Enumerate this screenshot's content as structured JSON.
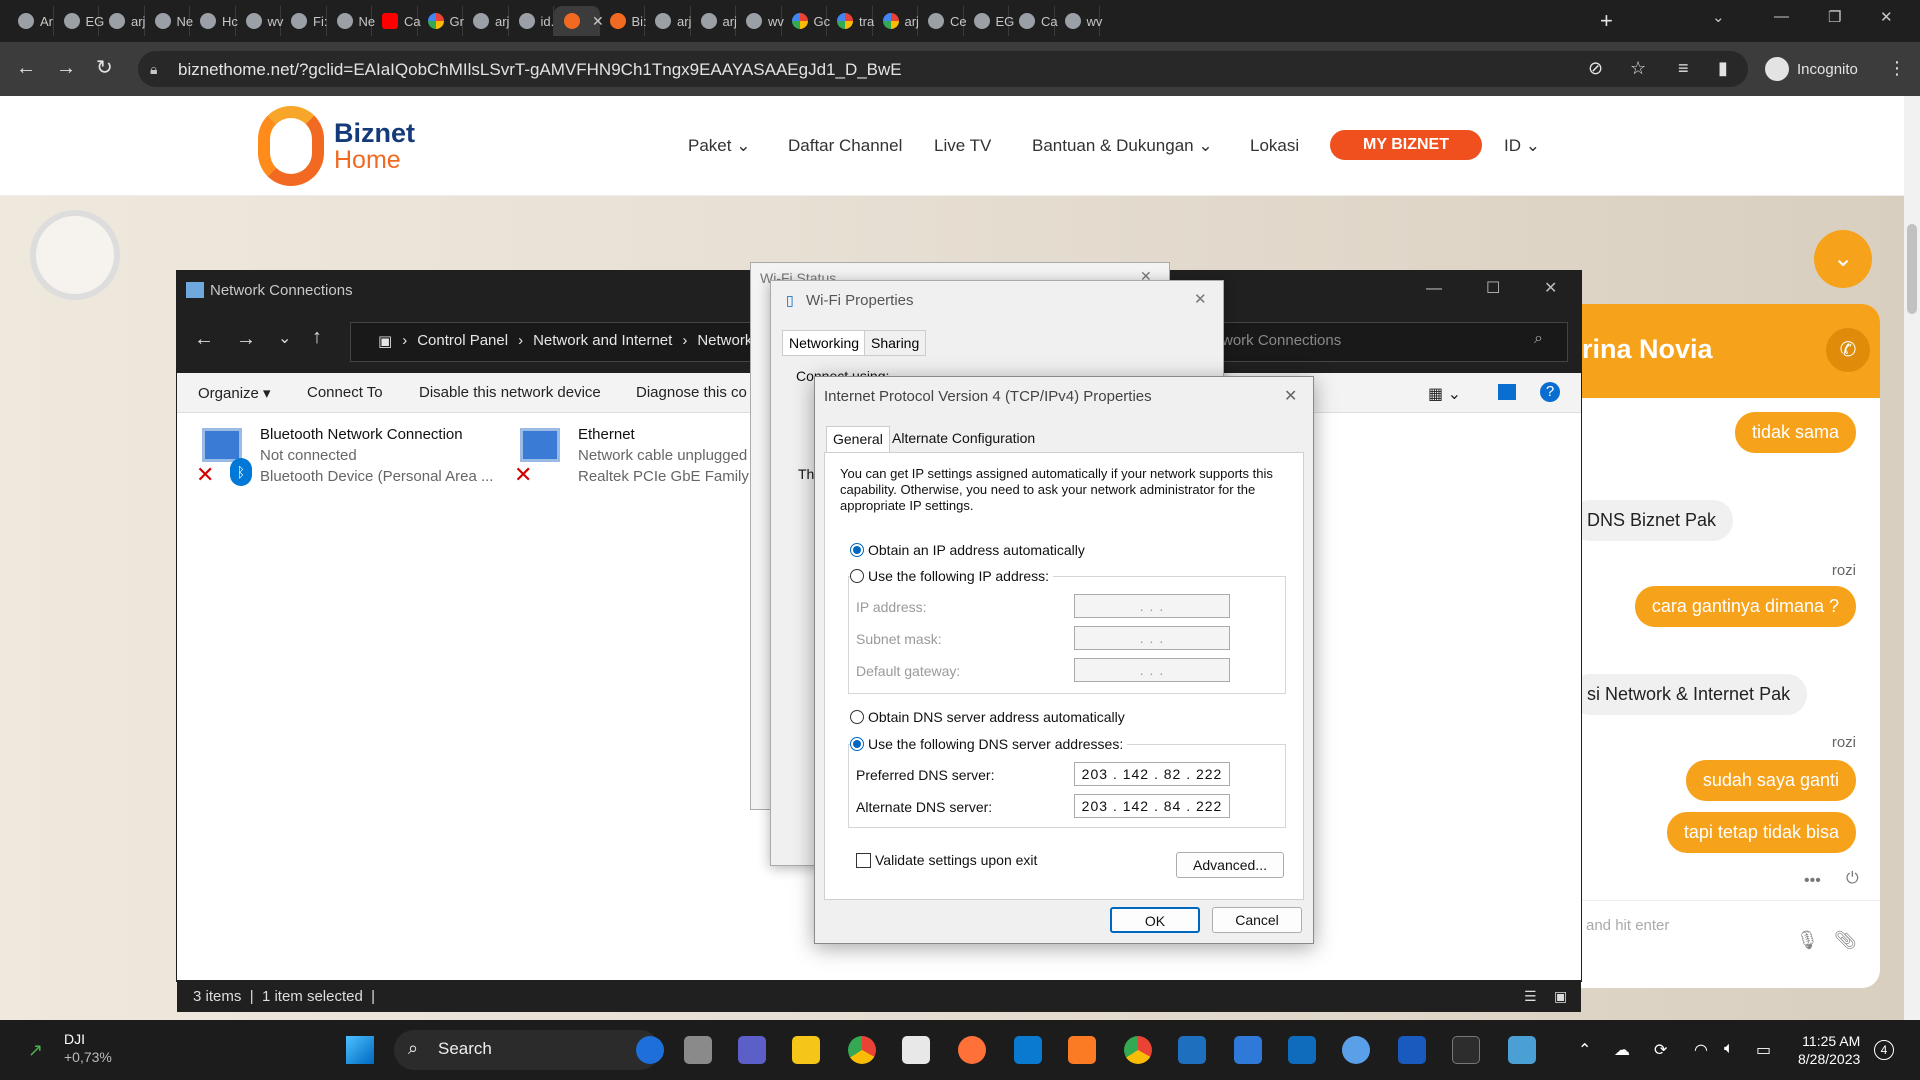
{
  "browser": {
    "tabs": [
      {
        "label": "Ar",
        "icon": "sync-icon"
      },
      {
        "label": "EG",
        "icon": "globe-icon"
      },
      {
        "label": "arj",
        "icon": "globe-icon"
      },
      {
        "label": "Ne",
        "icon": "incognito-icon"
      },
      {
        "label": "Hc",
        "icon": "leaf-icon"
      },
      {
        "label": "wv",
        "icon": "globe-icon"
      },
      {
        "label": "Fi:",
        "icon": "app-icon"
      },
      {
        "label": "Ne",
        "icon": "incognito-icon"
      },
      {
        "label": "Ca",
        "icon": "youtube-icon"
      },
      {
        "label": "Gr",
        "icon": "google-icon"
      },
      {
        "label": "arj",
        "icon": "globe-icon"
      },
      {
        "label": "id.",
        "icon": "globe-icon"
      },
      {
        "label": "",
        "icon": "biznet-icon",
        "active": true
      },
      {
        "label": "Bi:",
        "icon": "biznet-icon"
      },
      {
        "label": "arj",
        "icon": "globe-icon"
      },
      {
        "label": "arj",
        "icon": "globe-icon"
      },
      {
        "label": "wv",
        "icon": "globe-icon"
      },
      {
        "label": "Gc",
        "icon": "google-icon"
      },
      {
        "label": "tra",
        "icon": "google-icon"
      },
      {
        "label": "arj",
        "icon": "google-icon"
      },
      {
        "label": "Ce",
        "icon": "magnet-icon"
      },
      {
        "label": "EG",
        "icon": "globe-icon"
      },
      {
        "label": "Ca",
        "icon": "p-icon"
      },
      {
        "label": "wv",
        "icon": "globe-icon"
      }
    ],
    "url": "biznethome.net/?gclid=EAIaIQobChMIlsLSvrT-gAMVFHN9Ch1Tngx9EAAYASAAEgJd1_D_BwE",
    "incognito_label": "Incognito"
  },
  "site": {
    "logo_line1": "Biznet",
    "logo_line2": "Home",
    "nav": [
      "Paket",
      "Daftar Channel",
      "Live TV",
      "Bantuan & Dukungan",
      "Lokasi"
    ],
    "cta": "MY BIZNET",
    "lang": "ID"
  },
  "chat": {
    "agent_name": "rina Novia",
    "messages": [
      {
        "from": "me",
        "text": "tidak sama"
      },
      {
        "from": "them",
        "text": "DNS Biznet Pak"
      },
      {
        "from": "label",
        "text": "rozi"
      },
      {
        "from": "me",
        "text": "cara gantinya dimana ?"
      },
      {
        "from": "them",
        "text": "si Network & Internet Pak"
      },
      {
        "from": "label",
        "text": "rozi"
      },
      {
        "from": "me",
        "text": "sudah saya ganti"
      },
      {
        "from": "me",
        "text": "tapi tetap tidak bisa"
      }
    ],
    "input_placeholder": "and hit enter"
  },
  "explorer": {
    "title": "Network Connections",
    "breadcrumbs": [
      "Control Panel",
      "Network and Internet",
      "Network C"
    ],
    "search_placeholder": "work Connections",
    "commands": [
      "Organize ▾",
      "Connect To",
      "Disable this network device",
      "Diagnose this co"
    ],
    "items": [
      {
        "name": "Bluetooth Network Connection",
        "status": "Not connected",
        "device": "Bluetooth Device (Personal Area ..."
      },
      {
        "name": "Ethernet",
        "status": "Network cable unplugged",
        "device": "Realtek PCIe GbE Family C"
      }
    ],
    "status_items": "3 items",
    "status_selected": "1 item selected"
  },
  "wifi_status": {
    "title": "Wi-Fi Status"
  },
  "wifi_props": {
    "title": "Wi-Fi Properties",
    "tabs": [
      "Networking",
      "Sharing"
    ],
    "connect_using": "Connect using:",
    "this_conn": "Th"
  },
  "ipv4": {
    "title": "Internet Protocol Version 4 (TCP/IPv4) Properties",
    "tabs": [
      "General",
      "Alternate Configuration"
    ],
    "description": "You can get IP settings assigned automatically if your network supports this capability. Otherwise, you need to ask your network administrator for the appropriate IP settings.",
    "opt_ip_auto": "Obtain an IP address automatically",
    "opt_ip_manual": "Use the following IP address:",
    "ip_label": "IP address:",
    "mask_label": "Subnet mask:",
    "gateway_label": "Default gateway:",
    "empty_ip": ".      .      .",
    "opt_dns_auto": "Obtain DNS server address automatically",
    "opt_dns_manual": "Use the following DNS server addresses:",
    "pref_label": "Preferred DNS server:",
    "pref_value": "203 . 142 .  82 . 222",
    "alt_label": "Alternate DNS server:",
    "alt_value": "203 . 142 .  84 . 222",
    "validate": "Validate settings upon exit",
    "advanced": "Advanced...",
    "ok": "OK",
    "cancel": "Cancel"
  },
  "taskbar": {
    "stock_name": "DJI",
    "stock_change": "+0,73%",
    "search": "Search",
    "time": "11:25 AM",
    "date": "8/28/2023",
    "notifications": "4"
  }
}
